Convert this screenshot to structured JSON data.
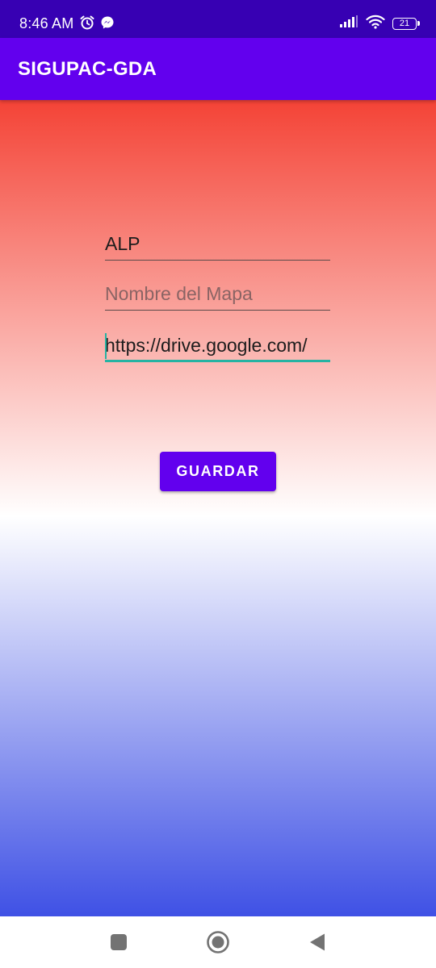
{
  "status_bar": {
    "time": "8:46 AM",
    "battery_level": "21",
    "icons": [
      "alarm-icon",
      "messenger-icon",
      "signal-icon",
      "wifi-icon",
      "battery-icon"
    ]
  },
  "app_bar": {
    "title": "SIGUPAC-GDA",
    "background_color": "#6200ee"
  },
  "form": {
    "field1": {
      "value": "ALP",
      "placeholder": ""
    },
    "field2": {
      "value": "",
      "placeholder": "Nombre del Mapa"
    },
    "field3": {
      "value": "https://drive.google.com/",
      "placeholder": ""
    },
    "save_label": "GUARDAR"
  },
  "colors": {
    "status_bar": "#3700b3",
    "accent": "#6200ee",
    "focus": "#26b3a3",
    "gradient_top": "#f44336",
    "gradient_middle": "#ffffff",
    "gradient_bottom": "#3f51e5"
  },
  "nav_bar": {
    "buttons": [
      "recents-square-icon",
      "home-circle-icon",
      "back-triangle-icon"
    ]
  }
}
